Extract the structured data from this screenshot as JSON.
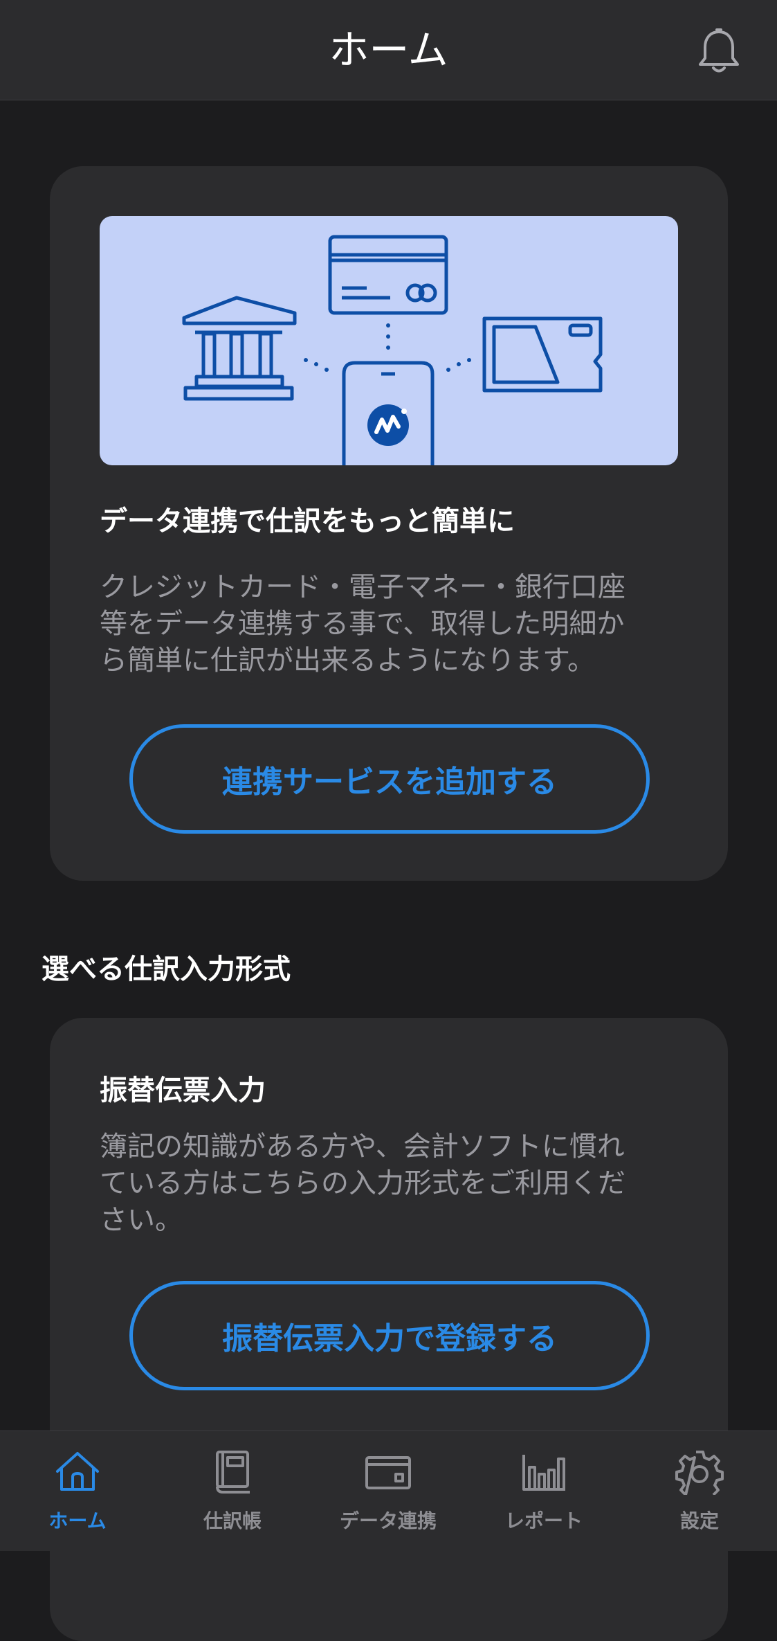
{
  "header": {
    "title": "ホーム",
    "bell_icon": "bell-icon"
  },
  "colors": {
    "accent": "#2a8ae6",
    "background": "#1c1c1e",
    "card": "#2c2c2e",
    "illustration_bg": "#c3d1f8",
    "illustration_stroke": "#0d4ea6"
  },
  "link_card": {
    "title": "データ連携で仕訳をもっと簡単に",
    "body_lines": [
      "クレジットカード・電子マネー・銀行口座",
      "等をデータ連携する事で、取得した明細か",
      "ら簡単に仕訳が出来るようになります。"
    ],
    "button": "連携サービスを追加する"
  },
  "section_heading": "選べる仕訳入力形式",
  "voucher_card": {
    "title": "振替伝票入力",
    "body_lines": [
      "簿記の知識がある方や、会計ソフトに慣れ",
      "ている方はこちらの入力形式をご利用くだ",
      "さい。"
    ],
    "button": "振替伝票入力で登録する"
  },
  "tabs": [
    {
      "label": "ホーム",
      "icon": "home-icon",
      "active": true
    },
    {
      "label": "仕訳帳",
      "icon": "journal-book-icon",
      "active": false
    },
    {
      "label": "データ連携",
      "icon": "card-wallet-icon",
      "active": false
    },
    {
      "label": "レポート",
      "icon": "bar-chart-icon",
      "active": false
    },
    {
      "label": "設定",
      "icon": "gear-icon",
      "active": false
    }
  ]
}
